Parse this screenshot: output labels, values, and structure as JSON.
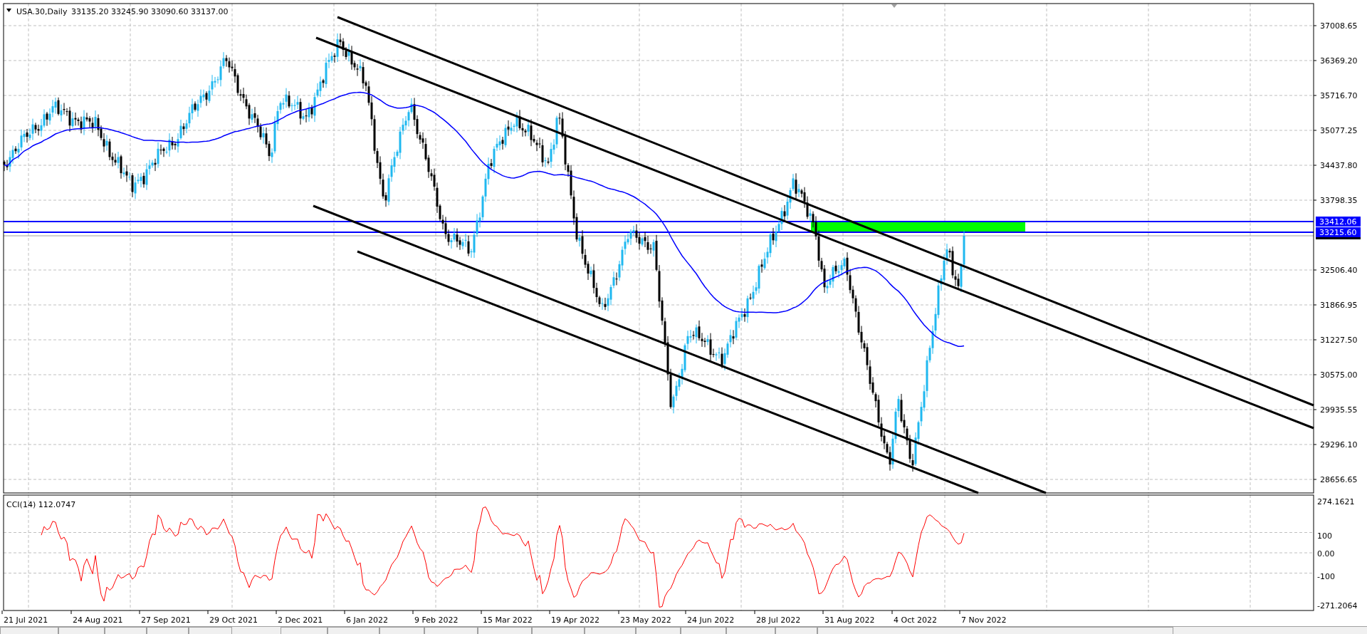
{
  "chart": {
    "symbol": "USA.30,Daily",
    "ohlc": "33135.20 33245.90 33090.60 33137.00",
    "price_axis": [
      "37008.65",
      "36369.20",
      "35716.70",
      "35077.25",
      "34437.80",
      "33798.35",
      "32506.40",
      "31866.95",
      "31227.50",
      "30575.00",
      "29935.55",
      "29296.10",
      "28656.65"
    ],
    "level_tags": [
      "33412.06",
      "33215.60"
    ],
    "indicator": {
      "label": "CCI(14) 112.0747",
      "axis": [
        "274.1621",
        "100",
        "0.00",
        "-100",
        "-271.2064"
      ]
    },
    "time_axis": [
      "21 Jul 2021",
      "24 Aug 2021",
      "27 Sep 2021",
      "29 Oct 2021",
      "2 Dec 2021",
      "6 Jan 2022",
      "9 Feb 2022",
      "15 Mar 2022",
      "19 Apr 2022",
      "23 May 2022",
      "24 Jun 2022",
      "28 Jul 2022",
      "31 Aug 2022",
      "4 Oct 2022",
      "7 Nov 2022"
    ]
  }
}
